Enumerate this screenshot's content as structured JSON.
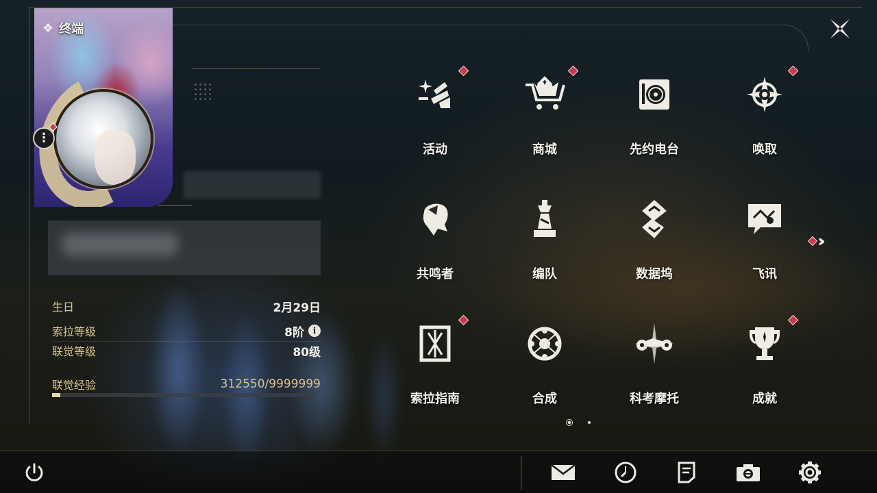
{
  "panel": {
    "title": "终端"
  },
  "profile": {
    "birthday_label": "生日",
    "birthday_value": "2月29日",
    "sola_level_label": "索拉等级",
    "sola_level_value": "8阶",
    "union_level_label": "联觉等级",
    "union_level_value": "80级",
    "exp_label": "联觉经验",
    "exp_value": "312550/9999999",
    "exp_progress": 0.031
  },
  "menu": {
    "items": [
      {
        "label": "活动",
        "icon": "sparkle-icon",
        "badge": true
      },
      {
        "label": "商城",
        "icon": "shopping-cart-icon",
        "badge": true
      },
      {
        "label": "先约电台",
        "icon": "radio-icon",
        "badge": false
      },
      {
        "label": "唤取",
        "icon": "compass-star-icon",
        "badge": true
      },
      {
        "label": "共鸣者",
        "icon": "character-head-icon",
        "badge": false
      },
      {
        "label": "编队",
        "icon": "chess-piece-icon",
        "badge": false
      },
      {
        "label": "数据坞",
        "icon": "data-dock-icon",
        "badge": false
      },
      {
        "label": "飞讯",
        "icon": "chat-bubble-icon",
        "badge": false
      },
      {
        "label": "索拉指南",
        "icon": "guide-book-icon",
        "badge": true
      },
      {
        "label": "合成",
        "icon": "synthesis-icon",
        "badge": false
      },
      {
        "label": "科考摩托",
        "icon": "motorcycle-icon",
        "badge": false
      },
      {
        "label": "成就",
        "icon": "trophy-icon",
        "badge": true
      }
    ],
    "pages": 2,
    "current_page": 1
  },
  "colors": {
    "accent_gold": "#d8c489",
    "badge_red": "#c93a4c",
    "text_light": "#f4f2ec"
  }
}
